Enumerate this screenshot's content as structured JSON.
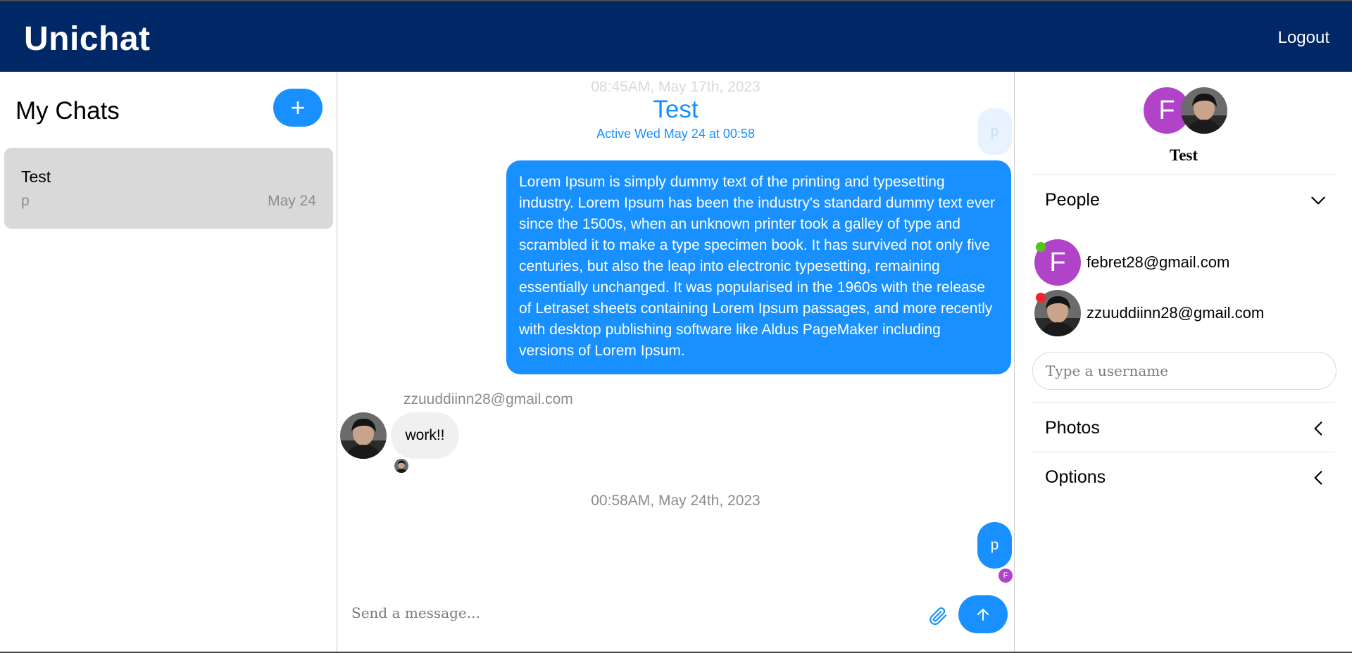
{
  "header": {
    "brand": "Unichat",
    "logout_label": "Logout",
    "bg_color": "#002766"
  },
  "sidebar": {
    "title": "My Chats",
    "add_label": "+",
    "chats": [
      {
        "title": "Test",
        "last_message": "p",
        "date": "May 24"
      }
    ]
  },
  "chat": {
    "title": "Test",
    "subtitle": "Active Wed May 24 at 00:58",
    "faded_timestamp": "08:45AM, May 17th, 2023",
    "faded_message": "p",
    "messages": [
      {
        "own": true,
        "text": "Lorem Ipsum is simply dummy text of the printing and typesetting industry. Lorem Ipsum has been the industry's standard dummy text ever since the 1500s, when an unknown printer took a galley of type and scrambled it to make a type specimen book. It has survived not only five centuries, but also the leap into electronic typesetting, remaining essentially unchanged. It was popularised in the 1960s with the release of Letraset sheets containing Lorem Ipsum passages, and more recently with desktop publishing software like Aldus PageMaker including versions of Lorem Ipsum."
      },
      {
        "own": false,
        "sender": "zzuuddiinn28@gmail.com",
        "text": "work!!"
      },
      {
        "own": true,
        "text": "p",
        "read_by_initial": "F"
      }
    ],
    "timestamp_2": "00:58AM, May 24th, 2023",
    "input_placeholder": "Send a message...",
    "accent_color": "#1890ff"
  },
  "details": {
    "avatar_initial": "F",
    "title": "Test",
    "people_label": "People",
    "people": [
      {
        "initial": "F",
        "email": "febret28@gmail.com",
        "status_color": "#52c41a"
      },
      {
        "initial": "",
        "email": "zzuuddiinn28@gmail.com",
        "status_color": "#f5222d"
      }
    ],
    "username_placeholder": "Type a username",
    "photos_label": "Photos",
    "options_label": "Options"
  }
}
